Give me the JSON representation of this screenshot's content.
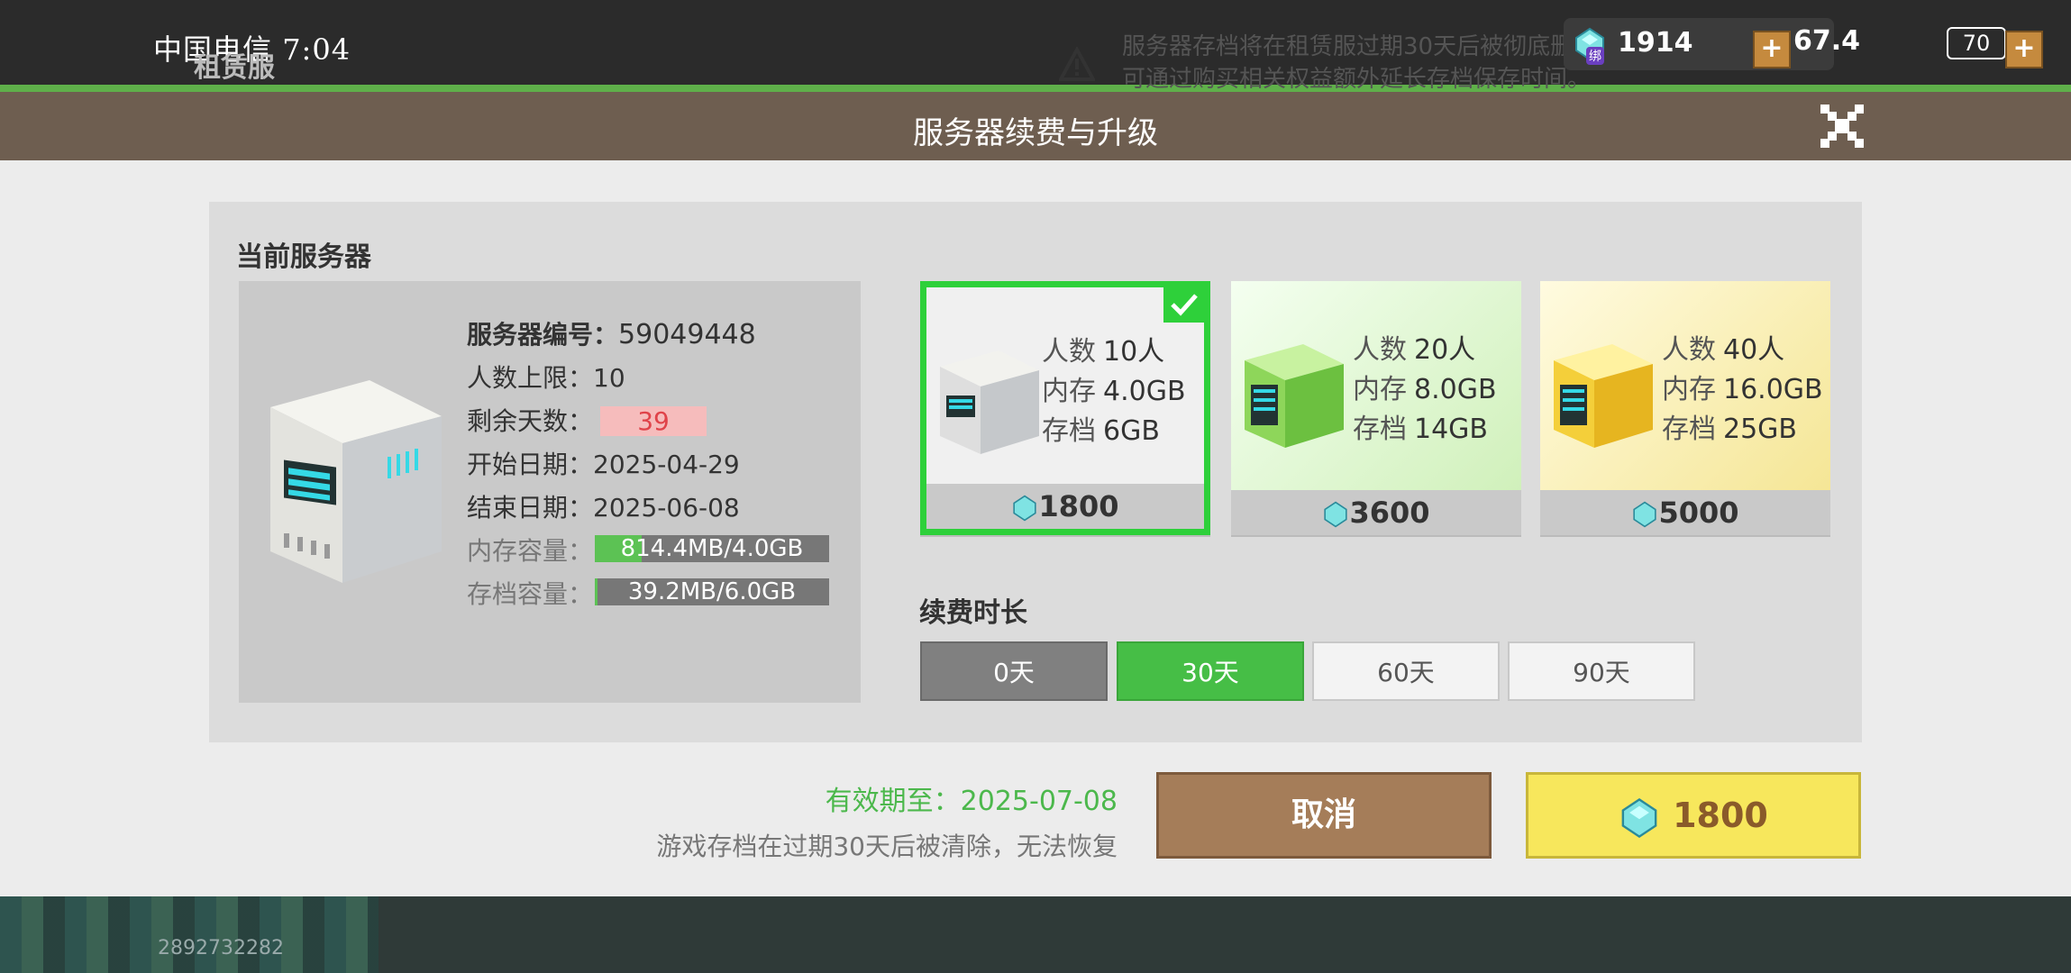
{
  "status": {
    "time": "7:04",
    "carrier": "中国电信",
    "signal": "67.4",
    "battery": "70"
  },
  "background": {
    "title": "租赁服",
    "notice_line1": "服务器存档将在租赁服过期30天后被彻底删除，无法恢复",
    "notice_line2": "可通过购买相关权益额外延长存档保存时间。",
    "currency_badge": "绑",
    "currency": "1914",
    "uid": "2892732282"
  },
  "dialog": {
    "title": "服务器续费与升级",
    "current_label": "当前服务器",
    "server_id_label": "服务器编号：",
    "server_id": "59049448",
    "max_players_label": "人数上限：",
    "max_players": "10",
    "days_left_label": "剩余天数：",
    "days_left": "39",
    "start_label": "开始日期：",
    "start_date": "2025-04-29",
    "end_label": "结束日期：",
    "end_date": "2025-06-08",
    "memory_label": "内存容量：",
    "memory_value": "814.4MB/4.0GB",
    "memory_fraction": 0.2,
    "storage_label": "存档容量：",
    "storage_value": "39.2MB/6.0GB",
    "storage_fraction": 0.01,
    "plans": [
      {
        "players_k": "人数",
        "players": "10人",
        "mem_k": "内存",
        "mem": "4.0GB",
        "save_k": "存档",
        "save": "6GB",
        "price": "1800"
      },
      {
        "players_k": "人数",
        "players": "20人",
        "mem_k": "内存",
        "mem": "8.0GB",
        "save_k": "存档",
        "save": "14GB",
        "price": "3600"
      },
      {
        "players_k": "人数",
        "players": "40人",
        "mem_k": "内存",
        "mem": "16.0GB",
        "save_k": "存档",
        "save": "25GB",
        "price": "5000"
      }
    ],
    "duration_label": "续费时长",
    "durations": [
      "0天",
      "30天",
      "60天",
      "90天"
    ],
    "valid_until": "有效期至：2025-07-08",
    "footer_note": "游戏存档在过期30天后被清除，无法恢复",
    "cancel": "取消",
    "buy_price": "1800"
  },
  "colors": {
    "accent_green": "#2ed03a",
    "header": "#6e5e50",
    "buy": "#f7e75c",
    "cancel": "#a57d59"
  }
}
